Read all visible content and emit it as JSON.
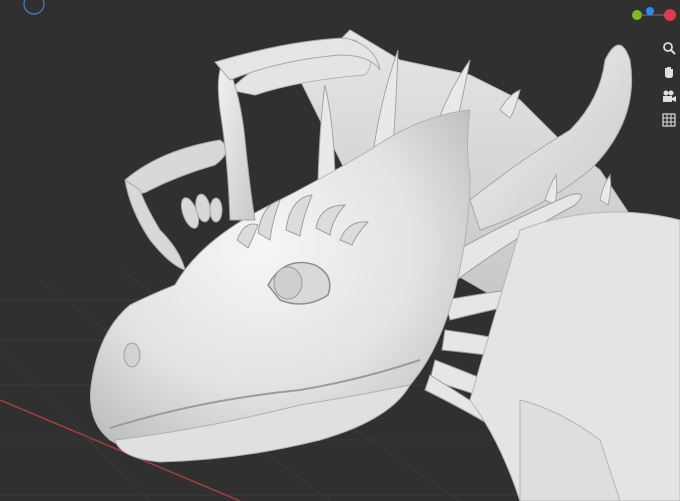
{
  "viewport": {
    "background": "#303030",
    "grid_color": "#3a3a3a",
    "x_axis_color": "#a43c3c",
    "model_color": "#e8e8e8"
  },
  "gizmo": {
    "axes": [
      {
        "name": "y",
        "color": "#7fbb22"
      },
      {
        "name": "z",
        "color": "#1f8fff"
      },
      {
        "name": "x",
        "color": "#e0394a"
      }
    ]
  },
  "nav_tools": [
    {
      "icon": "zoom-icon"
    },
    {
      "icon": "hand-icon"
    },
    {
      "icon": "camera-icon"
    },
    {
      "icon": "grid-icon"
    }
  ]
}
